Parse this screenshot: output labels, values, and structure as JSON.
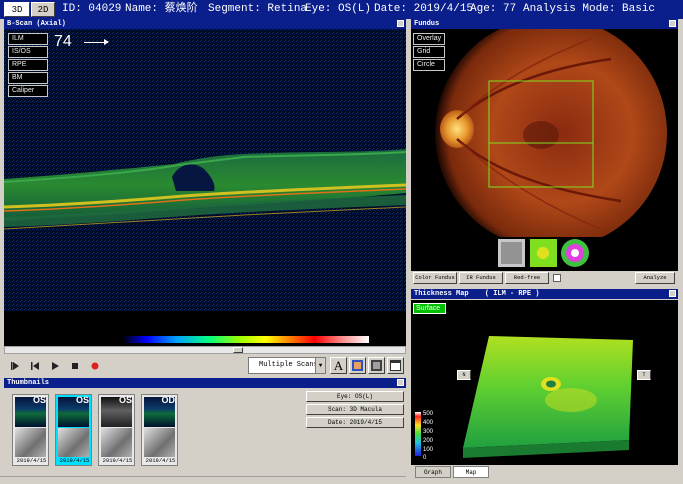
{
  "header": {
    "tabs": [
      "3D",
      "2D"
    ],
    "id": "ID: 04029",
    "name": "Name: 蔡焕阶",
    "segment": "Segment: Retina",
    "eye": "Eye: OS(L)",
    "date": "Date: 2019/4/15",
    "age": "Age: 77",
    "mode": "Analysis Mode: Basic"
  },
  "bscan": {
    "title": "B-Scan (Axial)",
    "slice_number": "74",
    "layers": [
      "ILM",
      "IS/OS",
      "RPE",
      "BM",
      "Caliper"
    ]
  },
  "transport": {
    "scan_mode": "Multiple Scans",
    "text_tool": "A"
  },
  "thumbnails": {
    "title": "Thumbnails",
    "items": [
      {
        "eye": "OS",
        "date": "2019/4/15"
      },
      {
        "eye": "OS",
        "date": "2019/4/15",
        "selected": true
      },
      {
        "eye": "OS",
        "date": "2019/4/15"
      },
      {
        "eye": "OD",
        "date": "2019/4/15"
      }
    ],
    "info": [
      "Eye: OS(L)",
      "Scan: 3D Macula",
      "Date: 2019/4/15"
    ]
  },
  "fundus": {
    "title": "Fundus",
    "overlays": [
      "Overlay",
      "Grid",
      "Circle"
    ],
    "toolbar": [
      "Color Fundus",
      "IR Fundus",
      "Red-free",
      "Analyze"
    ]
  },
  "thickness": {
    "title": "Thickness Map",
    "range": "( ILM - RPE )",
    "mode": "Surface",
    "nav": [
      "N",
      "T"
    ],
    "legend": [
      "500",
      "400",
      "300",
      "200",
      "100",
      "0"
    ],
    "tabs": [
      "Graph",
      "Map"
    ]
  }
}
